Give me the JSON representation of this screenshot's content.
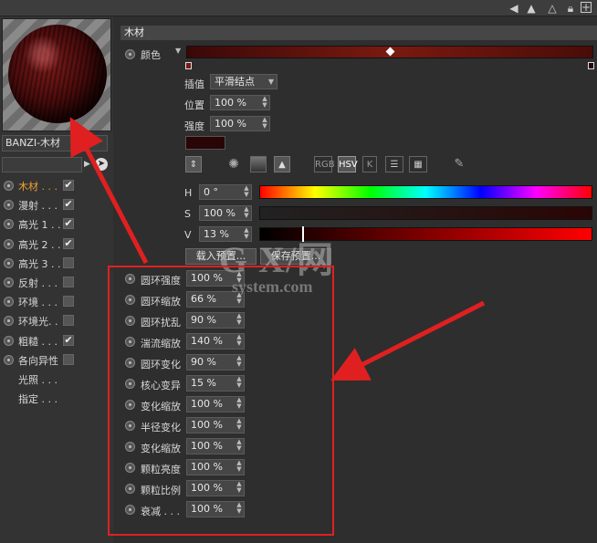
{
  "material_name": "BANZI-木材",
  "section_title": "木材",
  "color_label": "颜色",
  "interpolation": {
    "label": "插值",
    "value": "平滑结点"
  },
  "position": {
    "label": "位置",
    "value": "100 %"
  },
  "intensity": {
    "label": "强度",
    "value": "100 %"
  },
  "color_mode_buttons": [
    "RGB",
    "HSV",
    "K"
  ],
  "hsv": {
    "h": {
      "label": "H",
      "value": "0 °"
    },
    "s": {
      "label": "S",
      "value": "100 %"
    },
    "v": {
      "label": "V",
      "value": "13 %"
    }
  },
  "buttons": {
    "load_preset": "载入预置...",
    "save_preset": "保存预置..."
  },
  "channels": [
    {
      "label": "木材 . . .",
      "checked": true,
      "active": true,
      "has_check": true
    },
    {
      "label": "漫射 . . .",
      "checked": true,
      "active": false,
      "has_check": true
    },
    {
      "label": "高光 1 . .",
      "checked": true,
      "active": false,
      "has_check": true
    },
    {
      "label": "高光 2 . .",
      "checked": true,
      "active": false,
      "has_check": true
    },
    {
      "label": "高光 3 . .",
      "checked": false,
      "active": false,
      "has_check": true
    },
    {
      "label": "反射 . . .",
      "checked": false,
      "active": false,
      "has_check": true
    },
    {
      "label": "环境 . . .",
      "checked": false,
      "active": false,
      "has_check": true
    },
    {
      "label": "环境光. .",
      "checked": false,
      "active": false,
      "has_check": true
    },
    {
      "label": "粗糙 . . .",
      "checked": true,
      "active": false,
      "has_check": true
    },
    {
      "label": "各向异性",
      "checked": false,
      "active": false,
      "has_check": true
    },
    {
      "label": "光照 . . .",
      "checked": false,
      "active": false,
      "has_check": false
    },
    {
      "label": "指定 . . .",
      "checked": false,
      "active": false,
      "has_check": false
    }
  ],
  "params": [
    {
      "label": "圆环强度",
      "value": "100 %"
    },
    {
      "label": "圆环缩放",
      "value": "66 %"
    },
    {
      "label": "圆环扰乱",
      "value": "90 %"
    },
    {
      "label": "湍流缩放",
      "value": "140 %"
    },
    {
      "label": "圆环变化",
      "value": "90 %"
    },
    {
      "label": "核心变异",
      "value": "15 %"
    },
    {
      "label": "变化缩放",
      "value": "100 %"
    },
    {
      "label": "半径变化",
      "value": "100 %"
    },
    {
      "label": "变化缩放",
      "value": "100 %"
    },
    {
      "label": "颗粒亮度",
      "value": "100 %"
    },
    {
      "label": "颗粒比例",
      "value": "100 %"
    },
    {
      "label": "衰减 . . .",
      "value": "100 %"
    }
  ],
  "watermark": {
    "line1": "G X/网",
    "line2": "system.com"
  },
  "colors": {
    "annotation": "#e02020",
    "active_channel": "#f0a030",
    "wood_color": "#2a0505"
  }
}
